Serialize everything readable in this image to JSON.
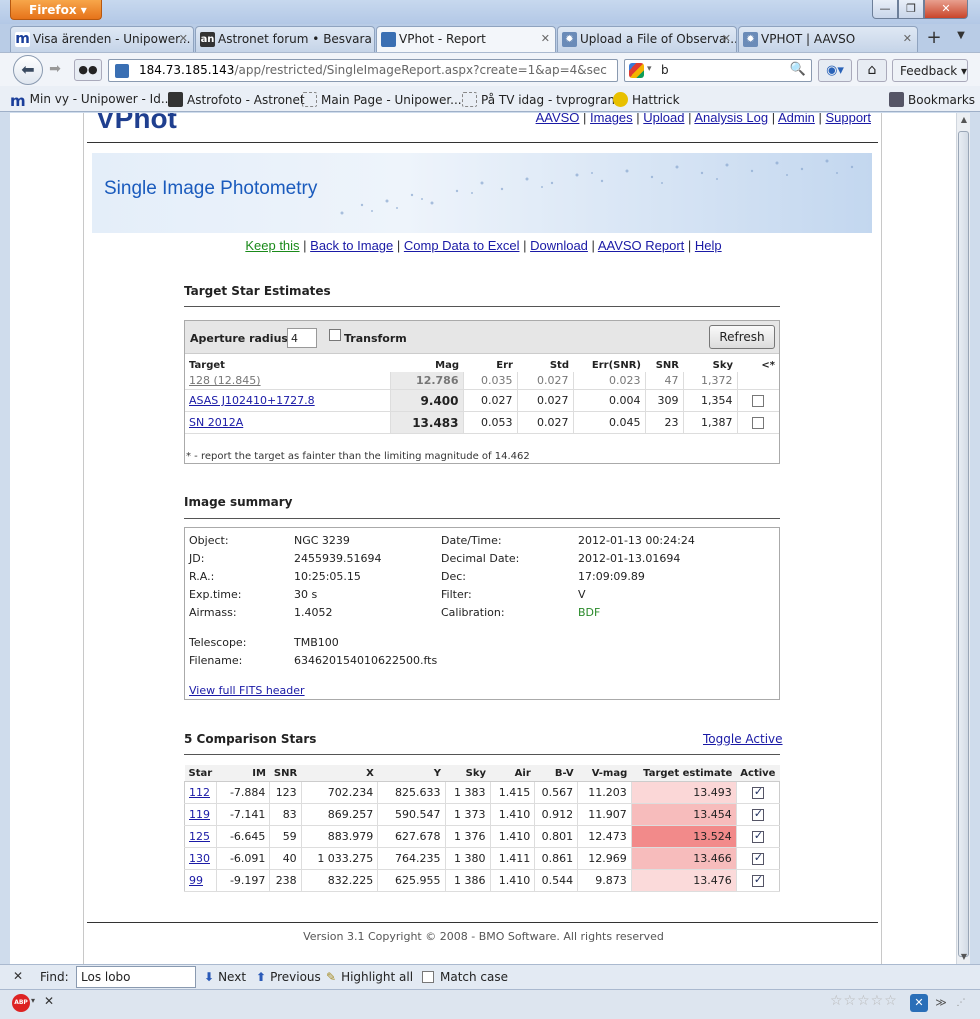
{
  "browser": {
    "menu_button": "Firefox",
    "window_controls": {
      "minimize": "—",
      "maximize": "❐",
      "close": "✕"
    },
    "tabs": [
      {
        "label": "Visa ärenden - Unipower...",
        "icon": "unipower-icon",
        "active": false
      },
      {
        "label": "Astronet forum • Besvara",
        "icon": "astronet-icon",
        "active": false
      },
      {
        "label": "VPhot - Report",
        "icon": "vphot-icon",
        "active": true
      },
      {
        "label": "Upload a File of Observa...",
        "icon": "aavso-icon",
        "active": false
      },
      {
        "label": "VPHOT | AAVSO",
        "icon": "aavso-icon",
        "active": false
      }
    ],
    "url_host": "184.73.185.143",
    "url_path": "/app/restricted/SingleImageReport.aspx?create=1&ap=4&sec",
    "search_value": "b",
    "feedback_label": "Feedback",
    "bookmarks": [
      {
        "label": "Min vy - Unipower - Id..."
      },
      {
        "label": "Astrofoto - Astronet"
      },
      {
        "label": "Main Page - Unipower..."
      },
      {
        "label": "På TV idag - tvprogram"
      },
      {
        "label": "Hattrick"
      }
    ],
    "bookmarks_menu": "Bookmarks"
  },
  "page": {
    "logo": "VPhot",
    "top_nav": [
      "AAVSO",
      "Images",
      "Upload",
      "Analysis Log",
      "Admin",
      "Support"
    ],
    "banner_title": "Single Image Photometry",
    "actions": [
      "Keep this",
      "Back to Image",
      "Comp Data to Excel",
      "Download",
      "AAVSO Report",
      "Help"
    ],
    "target_section": {
      "title": "Target Star Estimates",
      "aperture_label": "Aperture radius:",
      "aperture_value": "4",
      "transform_label": "Transform",
      "refresh_label": "Refresh",
      "columns": [
        "Target",
        "Mag",
        "Err",
        "Std",
        "Err(SNR)",
        "SNR",
        "Sky",
        "<*"
      ],
      "rows": [
        {
          "target": "128 (12.845)",
          "mag": "12.786",
          "err": "0.035",
          "std": "0.027",
          "err_snr": "0.023",
          "snr": "47",
          "sky": "1,372",
          "checkbox": false
        },
        {
          "target": "ASAS J102410+1727.8",
          "mag": "9.400",
          "err": "0.027",
          "std": "0.027",
          "err_snr": "0.004",
          "snr": "309",
          "sky": "1,354",
          "checkbox": true
        },
        {
          "target": "SN 2012A",
          "mag": "13.483",
          "err": "0.053",
          "std": "0.027",
          "err_snr": "0.045",
          "snr": "23",
          "sky": "1,387",
          "checkbox": true
        }
      ],
      "note": "* - report the target as fainter than the limiting magnitude of 14.462"
    },
    "summary": {
      "title": "Image summary",
      "object_label": "Object:",
      "object": "NGC 3239",
      "datetime_label": "Date/Time:",
      "datetime": "2012-01-13 00:24:24",
      "jd_label": "JD:",
      "jd": "2455939.51694",
      "decimal_label": "Decimal Date:",
      "decimal": "2012-01-13.01694",
      "ra_label": "R.A.:",
      "ra": "10:25:05.15",
      "dec_label": "Dec:",
      "dec": "17:09:09.89",
      "exp_label": "Exp.time:",
      "exp": "30 s",
      "filter_label": "Filter:",
      "filter": "V",
      "airmass_label": "Airmass:",
      "airmass": "1.4052",
      "calibration_label": "Calibration:",
      "calibration": "BDF",
      "telescope_label": "Telescope:",
      "telescope": "TMB100",
      "filename_label": "Filename:",
      "filename": "634620154010622500.fts",
      "fits_link": "View full FITS header"
    },
    "comparison": {
      "title": "5 Comparison Stars",
      "toggle_label": "Toggle Active",
      "columns": [
        "Star",
        "IM",
        "SNR",
        "X",
        "Y",
        "Sky",
        "Air",
        "B-V",
        "V-mag",
        "Target estimate",
        "Active"
      ],
      "rows": [
        {
          "star": "112",
          "im": "-7.884",
          "snr": "123",
          "x": "702.234",
          "y": "825.633",
          "sky": "1 383",
          "air": "1.415",
          "bv": "0.567",
          "vmag": "11.203",
          "est": "13.493",
          "active": true
        },
        {
          "star": "119",
          "im": "-7.141",
          "snr": "83",
          "x": "869.257",
          "y": "590.547",
          "sky": "1 373",
          "air": "1.410",
          "bv": "0.912",
          "vmag": "11.907",
          "est": "13.454",
          "active": true
        },
        {
          "star": "125",
          "im": "-6.645",
          "snr": "59",
          "x": "883.979",
          "y": "627.678",
          "sky": "1 376",
          "air": "1.410",
          "bv": "0.801",
          "vmag": "12.473",
          "est": "13.524",
          "active": true
        },
        {
          "star": "130",
          "im": "-6.091",
          "snr": "40",
          "x": "1 033.275",
          "y": "764.235",
          "sky": "1 380",
          "air": "1.411",
          "bv": "0.861",
          "vmag": "12.969",
          "est": "13.466",
          "active": true
        },
        {
          "star": "99",
          "im": "-9.197",
          "snr": "238",
          "x": "832.225",
          "y": "625.955",
          "sky": "1 386",
          "air": "1.410",
          "bv": "0.544",
          "vmag": "9.873",
          "est": "13.476",
          "active": true
        }
      ]
    },
    "footer": "Version 3.1 Copyright © 2008 - BMO Software. All rights reserved"
  },
  "findbar": {
    "label": "Find:",
    "value": "Los lobo",
    "next": "Next",
    "previous": "Previous",
    "highlight": "Highlight all",
    "match_case": "Match case"
  },
  "statusbar": {
    "adblock": "ABP"
  },
  "colors": {
    "accent": "#1f3f8f",
    "link": "#1a1aa6",
    "keep_link": "#1a8a1a",
    "calibration": "#2a8a2a"
  }
}
